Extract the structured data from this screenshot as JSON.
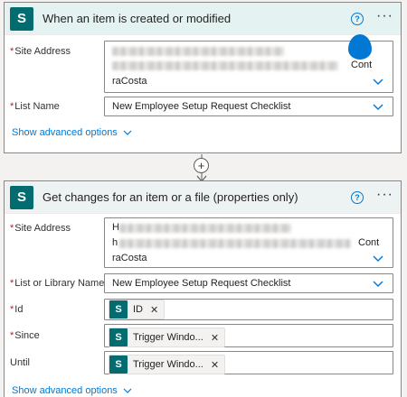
{
  "trigger": {
    "title": "When an item is created or modified",
    "site_label": "Site Address",
    "site_value_suffix_line2": "Cont",
    "site_value_line3": "raCosta",
    "list_label": "List Name",
    "list_value": "New Employee Setup Request Checklist",
    "advanced": "Show advanced options"
  },
  "connector": {
    "plus": "+"
  },
  "action": {
    "title": "Get changes for an item or a file (properties only)",
    "site_label": "Site Address",
    "site_value_prefix_line1": "H",
    "site_value_prefix_line2": "h",
    "site_value_suffix_line2": "Cont",
    "site_value_line3": "raCosta",
    "list_label": "List or Library Name",
    "list_value": "New Employee Setup Request Checklist",
    "id_label": "Id",
    "id_token": "ID",
    "since_label": "Since",
    "since_token": "Trigger Windo...",
    "until_label": "Until",
    "until_token": "Trigger Windo...",
    "advanced": "Show advanced options"
  },
  "common": {
    "help_glyph": "?",
    "more_glyph": "···",
    "token_remove_glyph": "✕",
    "required_mark": "*",
    "sp_letter": "S"
  },
  "colors": {
    "sharepoint_teal": "#036c70",
    "link_blue": "#0078d4",
    "required_red": "#a4262c"
  }
}
